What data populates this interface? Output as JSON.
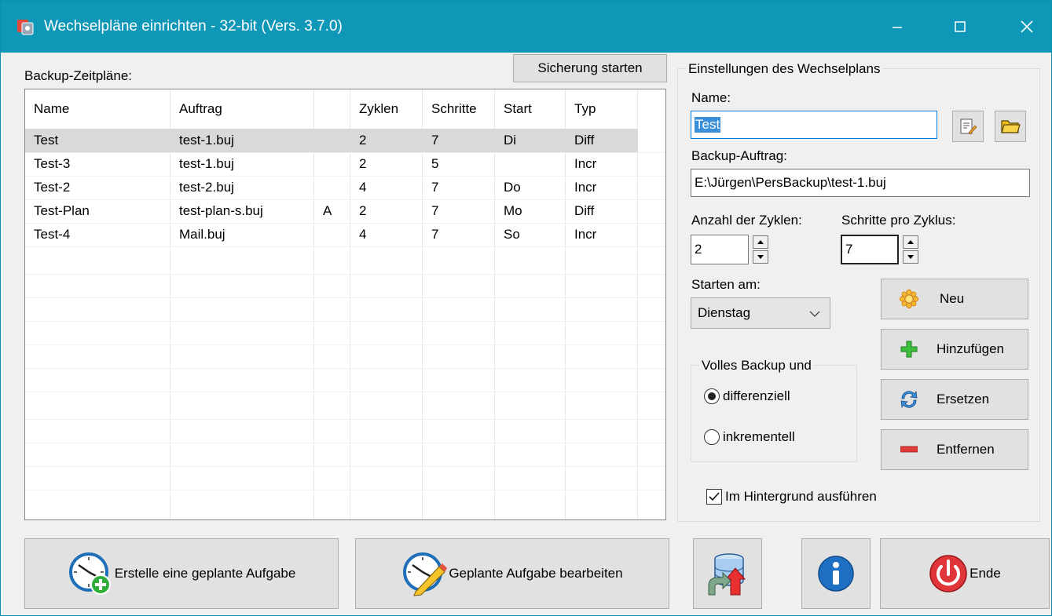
{
  "window": {
    "title": "Wechselpläne einrichten - 32-bit (Vers. 3.7.0)",
    "minimize_glyph": "—",
    "maximize_glyph": "☐",
    "close_glyph": "✕"
  },
  "left": {
    "list_label": "Backup-Zeitpläne:",
    "start_backup_label": "Sicherung starten",
    "columns": [
      "Name",
      "Auftrag",
      "",
      "Zyklen",
      "Schritte",
      "Start",
      "Typ"
    ],
    "rows": [
      [
        "Test",
        "test-1.buj",
        "",
        "2",
        "7",
        "Di",
        "Diff"
      ],
      [
        "Test-3",
        "test-1.buj",
        "",
        "2",
        "5",
        "",
        "Incr"
      ],
      [
        "Test-2",
        "test-2.buj",
        "",
        "4",
        "7",
        "Do",
        "Incr"
      ],
      [
        "Test-Plan",
        "test-plan-s.buj",
        "A",
        "2",
        "7",
        "Mo",
        "Diff"
      ],
      [
        "Test-4",
        "Mail.buj",
        "",
        "4",
        "7",
        "So",
        "Incr"
      ]
    ],
    "selected_row": 0
  },
  "settings": {
    "group_title": "Einstellungen des Wechselplans",
    "name_label": "Name:",
    "name_value": "Test",
    "job_label": "Backup-Auftrag:",
    "job_value": "E:\\Jürgen\\PersBackup\\test-1.buj",
    "cycles_label": "Anzahl der Zyklen:",
    "cycles_value": "2",
    "steps_label": "Schritte pro Zyklus:",
    "steps_value": "7",
    "start_label": "Starten am:",
    "start_value": "Dienstag",
    "full_backup_title": "Volles Backup und",
    "radio_diff": "differenziell",
    "radio_incr": "inkrementell",
    "radio_selected": "differenziell",
    "background_label": "Im Hintergrund ausführen",
    "background_checked": true,
    "btn_new": "Neu",
    "btn_add": "Hinzufügen",
    "btn_replace": "Ersetzen",
    "btn_remove": "Entfernen"
  },
  "bottom": {
    "create_task": "Erstelle eine geplante Aufgabe",
    "edit_task": "Geplante Aufgabe bearbeiten",
    "end": "Ende"
  },
  "colors": {
    "titlebar": "#0f97b8",
    "selection": "#3b8fd9",
    "row_selected": "#d9d9d9"
  }
}
